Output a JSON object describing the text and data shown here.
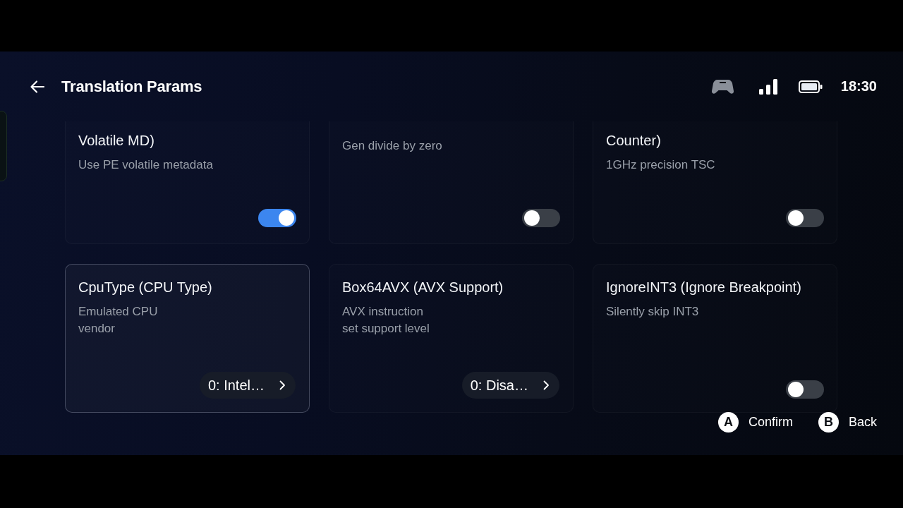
{
  "header": {
    "title": "Translation Params",
    "time": "18:30"
  },
  "cards": [
    {
      "kind": "toggle",
      "title": "Volatile MD)",
      "description": "Use PE volatile metadata",
      "on": true,
      "selected": false
    },
    {
      "kind": "toggle",
      "description": "Gen divide by zero",
      "on": false,
      "selected": false
    },
    {
      "kind": "toggle",
      "title": "Counter)",
      "description": "1GHz precision TSC",
      "on": false,
      "selected": false
    },
    {
      "kind": "select",
      "title": "CpuType (CPU Type)",
      "description": "Emulated CPU\nvendor",
      "value": "0: Intel…",
      "selected": true
    },
    {
      "kind": "select",
      "title": "Box64AVX (AVX Support)",
      "description": "AVX instruction\nset support level",
      "value": "0: Disa…",
      "selected": false
    },
    {
      "kind": "toggle",
      "title": "IgnoreINT3 (Ignore Breakpoint)",
      "description": "Silently skip INT3",
      "on": false,
      "selected": false
    }
  ],
  "hints": [
    {
      "key": "A",
      "label": "Confirm"
    },
    {
      "key": "B",
      "label": "Back"
    }
  ]
}
